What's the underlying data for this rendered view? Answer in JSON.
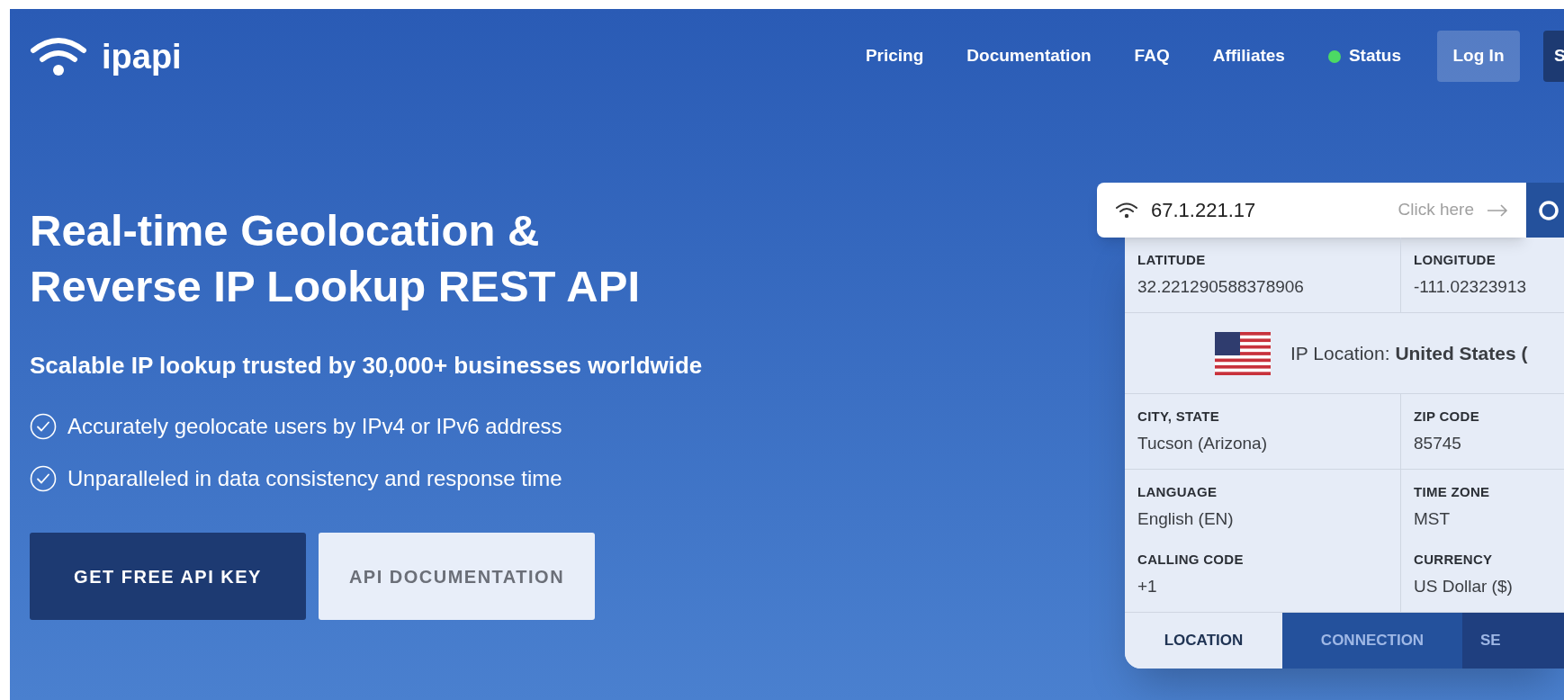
{
  "logo": {
    "text": "ipapi"
  },
  "nav": [
    {
      "label": "Pricing",
      "kind": "link"
    },
    {
      "label": "Documentation",
      "kind": "link"
    },
    {
      "label": "FAQ",
      "kind": "link"
    },
    {
      "label": "Affiliates",
      "kind": "link"
    },
    {
      "label": "Status",
      "kind": "status",
      "color": "#4cd964"
    },
    {
      "label": "Log In",
      "kind": "button"
    },
    {
      "label": "S",
      "kind": "primary"
    }
  ],
  "hero": {
    "title_lines": [
      "Real-time Geolocation &",
      "Reverse IP Lookup REST API"
    ],
    "subtitle": "Scalable IP lookup trusted by 30,000+ businesses worldwide",
    "features": [
      "Accurately geolocate users by IPv4 or IPv6 address",
      "Unparalleled in data consistency and response time"
    ],
    "buttons": [
      {
        "label": "GET FREE API KEY",
        "kind": "primary"
      },
      {
        "label": "API DOCUMENTATION",
        "kind": "secondary"
      }
    ]
  },
  "lookup": {
    "value": "67.1.221.17",
    "hint": "Click here",
    "sections": [
      {
        "kind": "pair",
        "left": [
          {
            "label": "LATITUDE",
            "value": "32.221290588378906"
          }
        ],
        "right": [
          {
            "label": "LONGITUDE",
            "value": "-111.02323913"
          }
        ]
      },
      {
        "kind": "location",
        "text": "IP Location: **United States (**"
      },
      {
        "kind": "pair",
        "left": [
          {
            "label": "CITY, STATE",
            "value": "Tucson (Arizona)"
          }
        ],
        "right": [
          {
            "label": "ZIP CODE",
            "value": "85745"
          }
        ]
      },
      {
        "kind": "pair",
        "left": [
          {
            "label": "LANGUAGE",
            "value": "English (EN)"
          },
          {
            "label": "CALLING CODE",
            "value": "+1"
          }
        ],
        "right": [
          {
            "label": "TIME ZONE",
            "value": "MST"
          },
          {
            "label": "CURRENCY",
            "value": "US Dollar ($)"
          }
        ]
      }
    ],
    "tabs": [
      {
        "label": "LOCATION",
        "selected": true
      },
      {
        "label": "CONNECTION",
        "selected": false
      },
      {
        "label": "SE",
        "selected": false
      }
    ]
  }
}
